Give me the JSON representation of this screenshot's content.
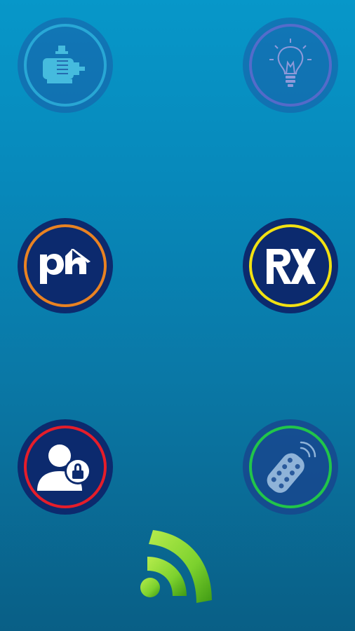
{
  "screen": {
    "background_top": "#0797c9",
    "background_bottom": "#095f86"
  },
  "tiles": [
    {
      "id": "motor",
      "icon": "motor-pump-icon",
      "ring_color": "#3cd2f0",
      "state": "faded"
    },
    {
      "id": "light",
      "icon": "light-bulb-icon",
      "ring_color": "#8c64dc",
      "state": "faded"
    },
    {
      "id": "ph",
      "icon": "ph-icon",
      "label": "ph",
      "ring_color": "#e98222",
      "state": "active"
    },
    {
      "id": "rx",
      "icon": "rx-icon",
      "label": "RX",
      "ring_color": "#f2e112",
      "state": "active"
    },
    {
      "id": "user",
      "icon": "user-lock-icon",
      "ring_color": "#e51d2a",
      "state": "active"
    },
    {
      "id": "remote",
      "icon": "remote-control-icon",
      "ring_color": "#21c54a",
      "state": "active"
    }
  ],
  "wifi": {
    "icon": "wifi-signal-icon",
    "color": "#7cd12e"
  }
}
